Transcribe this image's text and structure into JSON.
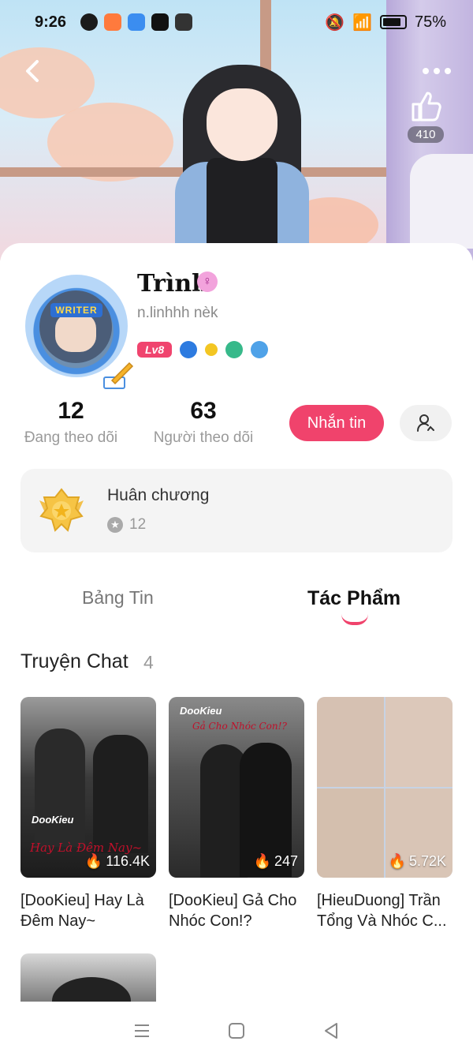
{
  "status_bar": {
    "time": "9:26",
    "battery": "75%"
  },
  "header": {
    "likes": "410",
    "back_icon": "chevron-left-icon",
    "more_icon": "ellipsis-icon"
  },
  "profile": {
    "writer_badge": "WRITER",
    "name": "Trình",
    "handle": "n.linhhh nèk",
    "level": "Lv8",
    "gender_symbol": "♀"
  },
  "stats": {
    "following_count": "12",
    "following_label": "Đang theo dõi",
    "followers_count": "63",
    "followers_label": "Người theo dõi"
  },
  "actions": {
    "message_label": "Nhắn tin"
  },
  "medals": {
    "title": "Huân chương",
    "count": "12"
  },
  "tabs": [
    {
      "label": "Bảng Tin",
      "active": false
    },
    {
      "label": "Tác Phẩm",
      "active": true
    }
  ],
  "section": {
    "title": "Truyện Chat",
    "count": "4"
  },
  "stories": [
    {
      "title": "[DooKieu] Hay Là Đêm Nay~",
      "views": "116.4K",
      "brand": "DooKieu",
      "script": "Hay Là Đêm Nay~"
    },
    {
      "title": "[DooKieu] Gả Cho Nhóc Con!?",
      "views": "247",
      "brand": "DooKieu",
      "script": "Gả Cho Nhóc Con!?"
    },
    {
      "title": "[HieuDuong] Trần Tổng Và Nhóc C...",
      "views": "5.72K"
    }
  ],
  "colors": {
    "accent": "#f0436c",
    "level_badge": "#f0446e"
  }
}
